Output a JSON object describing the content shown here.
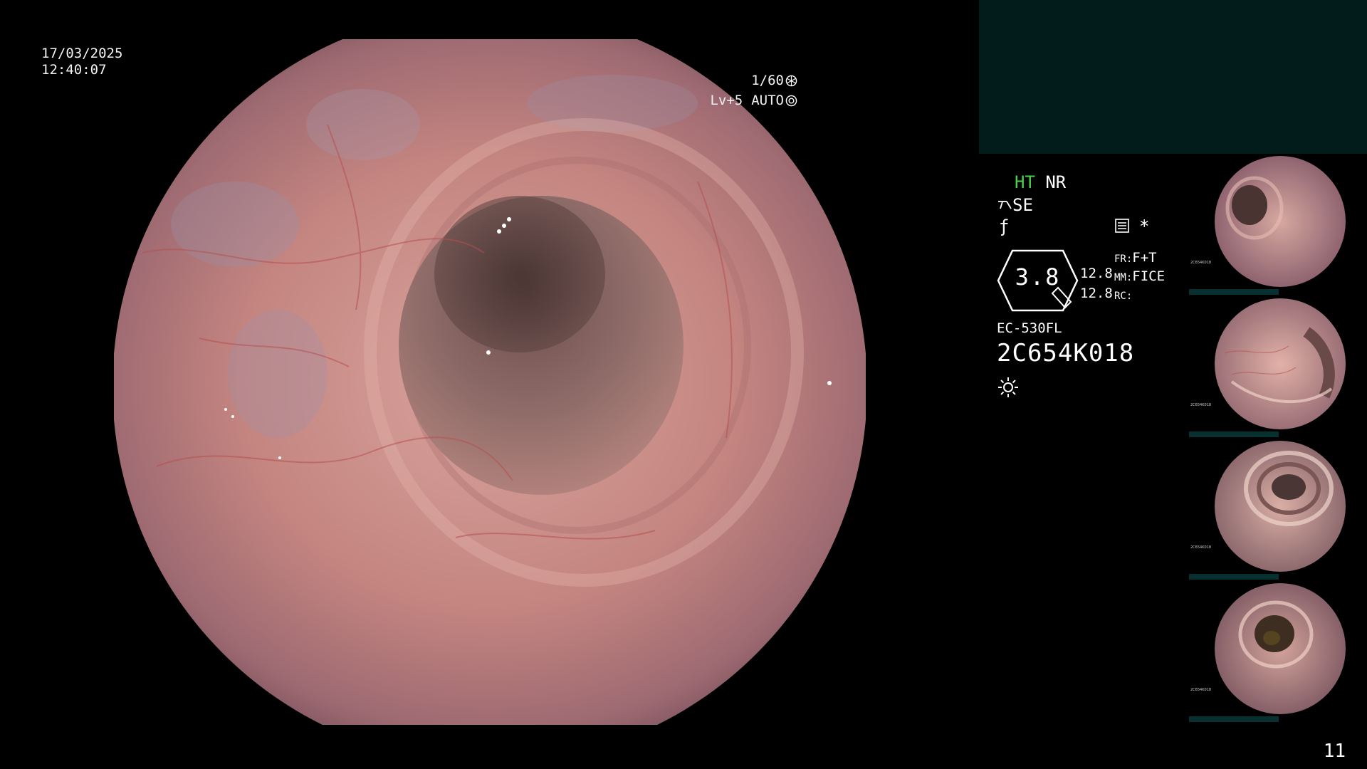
{
  "overlay": {
    "date": "17/03/2025",
    "time": "12:40:07",
    "shutter": "1/60",
    "shutter_icon": "aperture-icon",
    "light_level": "Lv+5",
    "iris_mode": "AUTO",
    "iris_icon": "iris-icon"
  },
  "status": {
    "ht": "HT",
    "nr": "NR",
    "se": "SE",
    "structure_enhancement_icon": "wand-icon",
    "f_symbol": "ƒ",
    "record_icon": "book-icon",
    "star": "*",
    "magnification": "3.8",
    "mag_values": [
      "12.8",
      "12.8"
    ],
    "fr_label": "FR:",
    "fr_value": "F+T",
    "mm_label": "MM:",
    "mm_value": "FICE",
    "rc_label": "RC:",
    "rc_value": "",
    "scope_model": "EC-530FL",
    "scope_serial": "2C654K018",
    "light_icon": "sun-icon"
  },
  "thumbnails": [
    {
      "label": "capture-1",
      "caption": "2C654K018"
    },
    {
      "label": "capture-2",
      "caption": "2C654K018"
    },
    {
      "label": "capture-3",
      "caption": "2C654K018"
    },
    {
      "label": "capture-4",
      "caption": "2C654K018"
    }
  ],
  "page_number": "11",
  "colors": {
    "ht_green": "#4dd14d",
    "panel_teal": "#021c1c",
    "mucosa": "#c98a86"
  }
}
